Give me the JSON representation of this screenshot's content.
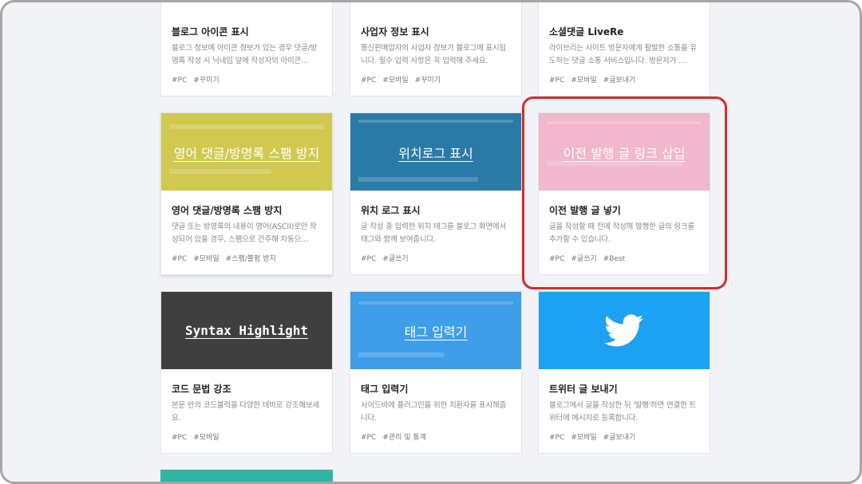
{
  "colors": {
    "background": "#f1f3f6",
    "highlight_border": "#d62a2f",
    "accent_salmon": "#f7a996",
    "accent_cyan": "#3db7dc",
    "yellow_thumb": "#d0c950",
    "teal_thumb": "#2a7aa6",
    "pink_thumb": "#f1b7cc",
    "dark_thumb": "#3f3f3f",
    "blue_thumb": "#3f9ee8",
    "twitter_blue": "#1da1f2",
    "green_thumb": "#2fb6a5"
  },
  "row1": [
    {
      "title": "블로그 아이콘 표시",
      "desc": "블로그 정보에 아이콘 정보가 있는 경우 댓글/방명록 작성 시 닉네임 앞에 작성자의 아이콘…",
      "tags": [
        "#PC",
        "#꾸미기"
      ]
    },
    {
      "title": "사업자 정보 표시",
      "desc": "통신판매업자의 사업자 정보가 블로그에 표시됩니다. 필수 입력 사항은 꼭 입력해 주세요.",
      "tags": [
        "#PC",
        "#모바일",
        "#꾸미기"
      ]
    },
    {
      "title": "소셜댓글 LiveRe",
      "desc": "라이브리는 사이트 방문자에게 활발한 소통을 유도하는 댓글 소통 서비스입니다. 방문자가 …",
      "tags": [
        "#PC",
        "#모바일",
        "#글보내기"
      ]
    }
  ],
  "row2": [
    {
      "thumb_text": "영어 댓글/방명록 스팸 방지",
      "title": "영어 댓글/방명록 스팸 방지",
      "desc": "댓글 또는 방명록의 내용이 영어(ASCII)로만 작성되어 있을 경우, 스팸으로 간주해 자동으…",
      "tags": [
        "#PC",
        "#모바일",
        "#스팸/불펌 방지"
      ]
    },
    {
      "thumb_text": "위치로그 표시",
      "title": "위치 로그 표시",
      "desc": "글 작성 중 입력한 위치 태그를 블로그 화면에서 태그와 함께 보여줍니다.",
      "tags": [
        "#PC",
        "#글쓰기"
      ]
    },
    {
      "thumb_text": "이전 발행 글 링크 삽입",
      "title": "이전 발행 글 넣기",
      "desc": "글을 작성할 때 전에 작성해 발행한 글의 링크를 추가할 수 있습니다.",
      "tags": [
        "#PC",
        "#글쓰기",
        "#Best"
      ]
    }
  ],
  "row3": [
    {
      "thumb_text": "Syntax Highlight",
      "title": "코드 문법 강조",
      "desc": "본문 안의 코드블럭을 다양한 테마로 강조해보세요.",
      "tags": [
        "#PC",
        "#모바일"
      ]
    },
    {
      "thumb_text": "태그 입력기",
      "title": "태그 입력기",
      "desc": "사이드바에 플러그인을 위한 치환자를 표시해줍니다.",
      "tags": [
        "#PC",
        "#관리 및 통계"
      ]
    },
    {
      "icon": "twitter-bird-icon",
      "title": "트위터 글 보내기",
      "desc": "블로그에서 글을 작성한 뒤 '발행'하면 연결한 트위터에 메시지로 등록합니다.",
      "tags": [
        "#PC",
        "#모바일",
        "#글보내기"
      ]
    }
  ]
}
